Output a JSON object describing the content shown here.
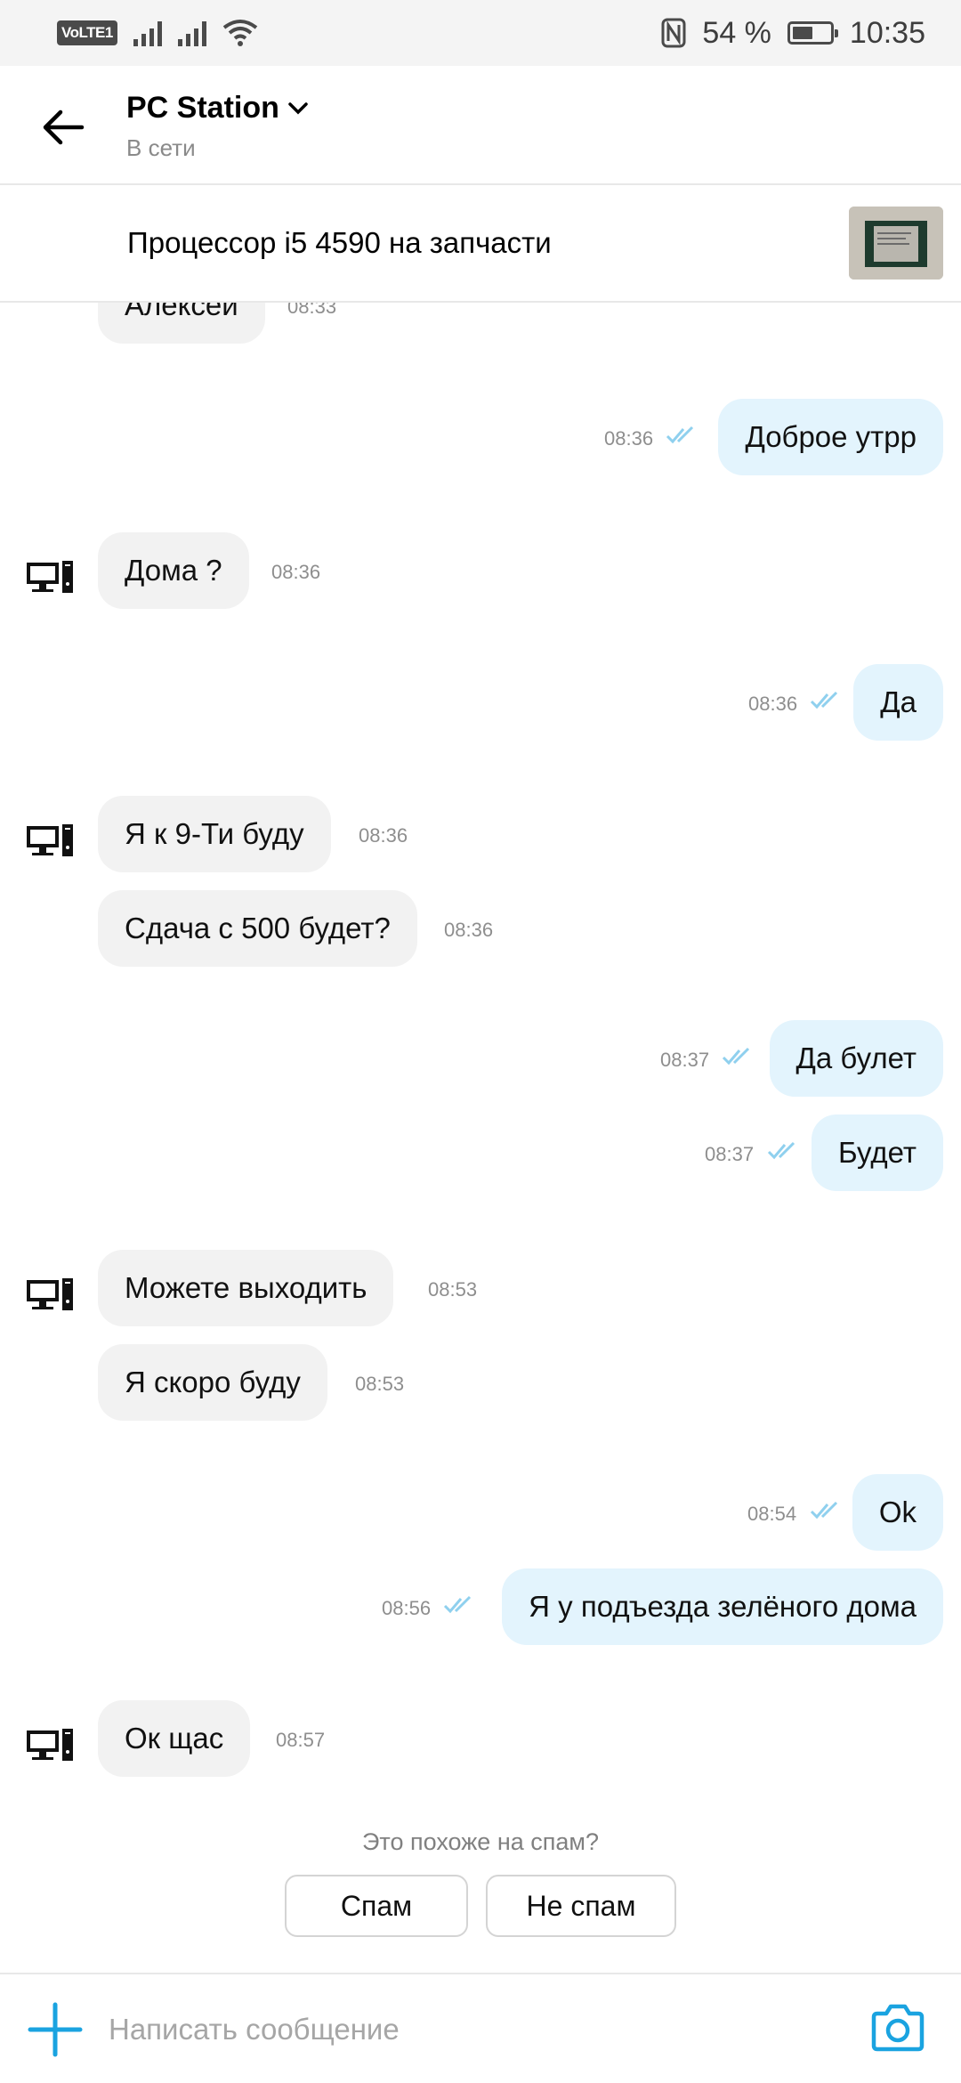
{
  "status_bar": {
    "volte": "VoLTE",
    "sim": "1",
    "battery": "54 %",
    "battery_level": 0.54,
    "time": "10:35"
  },
  "header": {
    "title": "PC Station",
    "subtitle": "В сети"
  },
  "item": {
    "title": "Процессор i5 4590 на запчасти"
  },
  "messages": [
    {
      "dir": "in",
      "text": "Алексей",
      "time": "08:33"
    },
    {
      "dir": "out",
      "text": "Доброе утрр",
      "time": "08:36"
    },
    {
      "dir": "in",
      "text": "Дома ?",
      "time": "08:36"
    },
    {
      "dir": "out",
      "text": "Да",
      "time": "08:36"
    },
    {
      "dir": "in",
      "text": "Я к 9-Ти буду",
      "time": "08:36"
    },
    {
      "dir": "in",
      "text": "Сдача с 500 будет?",
      "time": "08:36"
    },
    {
      "dir": "out",
      "text": "Да булет",
      "time": "08:37"
    },
    {
      "dir": "out",
      "text": "Будет",
      "time": "08:37"
    },
    {
      "dir": "in",
      "text": "Можете выходить",
      "time": "08:53"
    },
    {
      "dir": "in",
      "text": "Я скоро буду",
      "time": "08:53"
    },
    {
      "dir": "out",
      "text": "Ok",
      "time": "08:54"
    },
    {
      "dir": "out",
      "text": "Я у подъезда зелёного дома",
      "time": "08:56"
    },
    {
      "dir": "in",
      "text": "Ок щас",
      "time": "08:57"
    }
  ],
  "spam": {
    "question": "Это похоже на спам?",
    "spam_label": "Спам",
    "not_spam_label": "Не спам"
  },
  "composer": {
    "placeholder": "Написать сообщение"
  },
  "colors": {
    "accent": "#1aa3e0",
    "outgoing_bubble": "#e3f4fd",
    "incoming_bubble": "#f2f2f2",
    "read_ticks": "#8fd0ee"
  },
  "icons": {
    "back": "arrow-left-icon",
    "dropdown": "chevron-down-icon",
    "avatar": "computer-icon",
    "add": "plus-icon",
    "camera": "camera-icon",
    "read": "double-check-icon"
  }
}
